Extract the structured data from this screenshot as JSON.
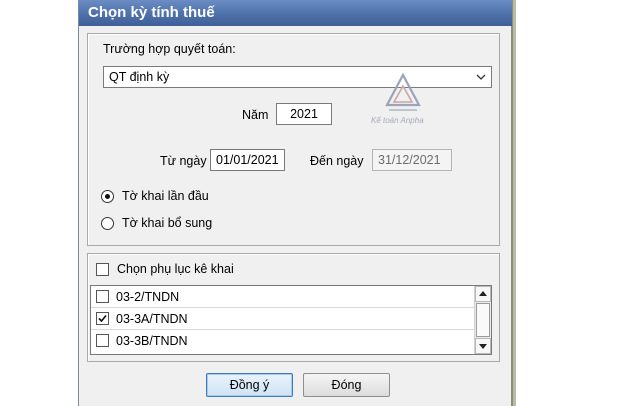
{
  "dialog": {
    "title": "Chọn kỳ tính thuế"
  },
  "settlement": {
    "label": "Trường hợp quyết toán:",
    "selected": "QT định kỳ"
  },
  "year": {
    "label": "Năm",
    "value": "2021"
  },
  "period": {
    "from_label": "Từ ngày",
    "from_value": "01/01/2021",
    "to_label": "Đến ngày",
    "to_value": "31/12/2021"
  },
  "declaration_type": {
    "options": [
      {
        "label": "Tờ khai lần đầu",
        "selected": true
      },
      {
        "label": "Tờ khai bổ sung",
        "selected": false
      }
    ]
  },
  "appendix": {
    "label": "Chọn phụ lục kê khai",
    "items": [
      {
        "label": "03-2/TNDN",
        "checked": false
      },
      {
        "label": "03-3A/TNDN",
        "checked": true
      },
      {
        "label": "03-3B/TNDN",
        "checked": false
      }
    ]
  },
  "watermark": {
    "text": "Kế toán Anpha"
  },
  "buttons": {
    "ok": "Đồng ý",
    "close": "Đóng"
  },
  "colors": {
    "title_bar": "#4e70a9",
    "dialog_bg": "#f0f0f0",
    "default_button_border": "#3d7bbf"
  }
}
